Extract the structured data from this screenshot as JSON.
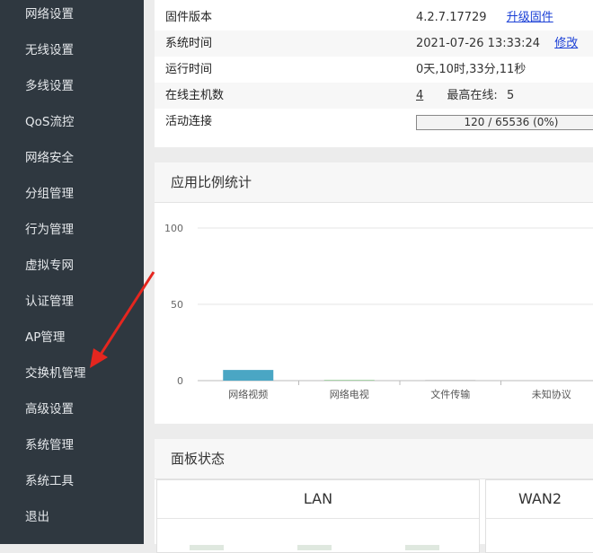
{
  "sidebar": {
    "items": [
      {
        "label": "网络设置"
      },
      {
        "label": "无线设置"
      },
      {
        "label": "多线设置"
      },
      {
        "label": "QoS流控"
      },
      {
        "label": "网络安全"
      },
      {
        "label": "分组管理"
      },
      {
        "label": "行为管理"
      },
      {
        "label": "虚拟专网"
      },
      {
        "label": "认证管理"
      },
      {
        "label": "AP管理"
      },
      {
        "label": "交换机管理"
      },
      {
        "label": "高级设置"
      },
      {
        "label": "系统管理"
      },
      {
        "label": "系统工具"
      },
      {
        "label": "退出"
      }
    ]
  },
  "status": {
    "firmware_label": "固件版本",
    "firmware_value": "4.2.7.17729",
    "firmware_upgrade_link": "升级固件",
    "time_label": "系统时间",
    "time_value": "2021-07-26 13:33:24",
    "time_edit_link": "修改",
    "uptime_label": "运行时间",
    "uptime_value": "0天,10时,33分,11秒",
    "hosts_label": "在线主机数",
    "hosts_value": "4",
    "max_online_label": "最高在线:",
    "max_online_value": "5",
    "connections_label": "活动连接",
    "connections_value": "120 / 65536 (0%)",
    "connections_fraction": 0.0018
  },
  "app_stats": {
    "title": "应用比例统计"
  },
  "chart_data": {
    "type": "bar",
    "categories": [
      "网络视频",
      "网络电视",
      "文件传输",
      "未知协议"
    ],
    "values": [
      7,
      0.5,
      0.3,
      0
    ],
    "ylim": [
      0,
      100
    ],
    "yticks": [
      "0",
      "50",
      "100"
    ],
    "colors": [
      "#4aa6c4",
      "#a9d5a9",
      "#cfcfcf",
      "#cfcfcf"
    ],
    "grid": true
  },
  "panel": {
    "title": "面板状态",
    "lan_label": "LAN",
    "wan2_label": "WAN2"
  },
  "colors": {
    "sidebar_bg": "#2f3840",
    "link": "#1a3fd6",
    "arrow": "#e5261f"
  }
}
